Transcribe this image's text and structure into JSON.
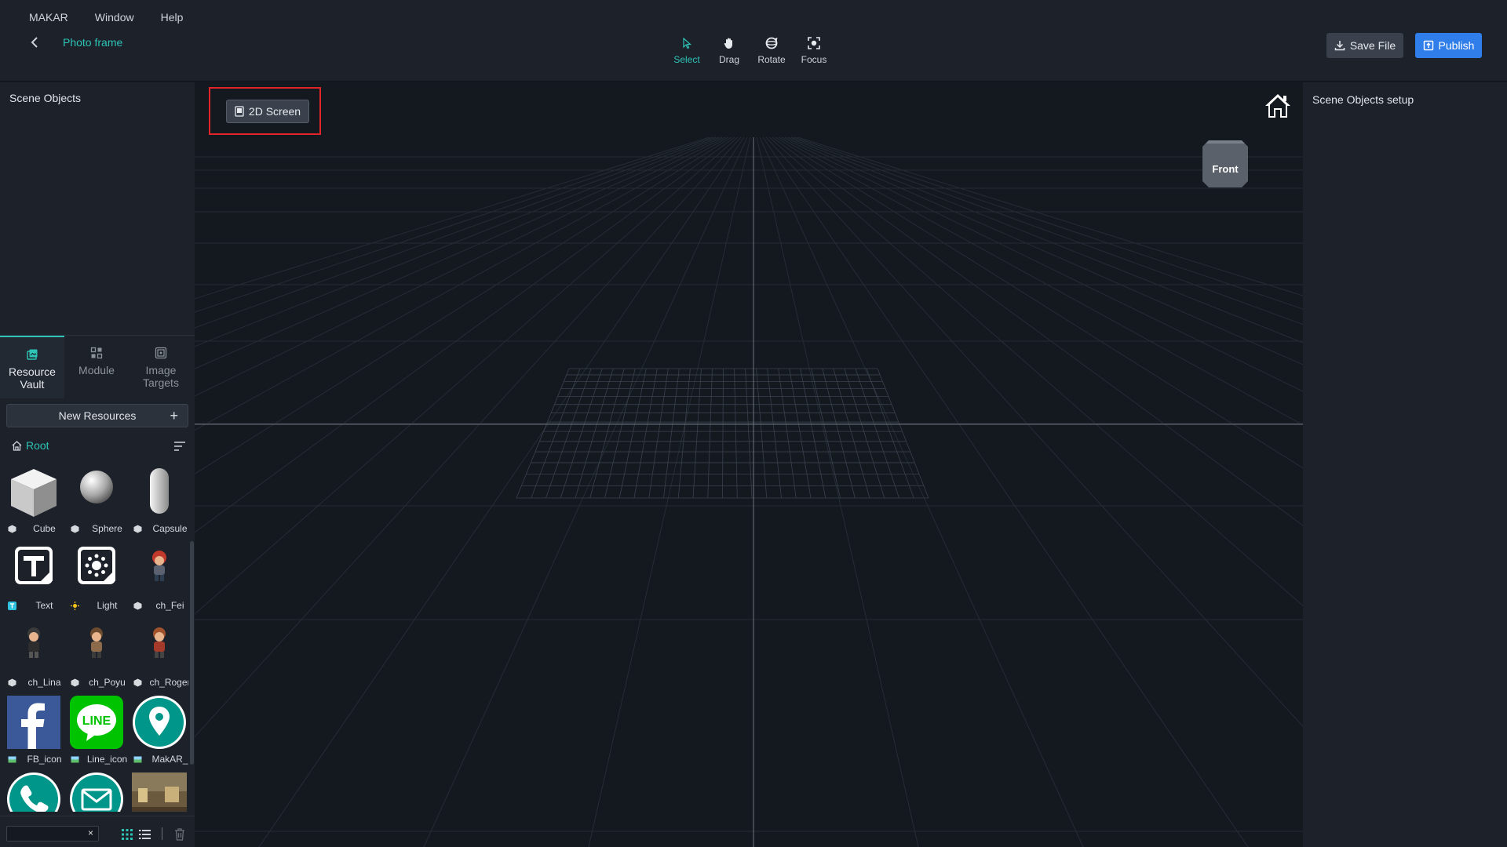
{
  "menu": {
    "items": [
      "MAKAR",
      "Window",
      "Help"
    ]
  },
  "header": {
    "project_name": "Photo frame"
  },
  "tools": [
    {
      "label": "Select",
      "icon": "cursor-icon",
      "active": true
    },
    {
      "label": "Drag",
      "icon": "hand-icon",
      "active": false
    },
    {
      "label": "Rotate",
      "icon": "rotate-icon",
      "active": false
    },
    {
      "label": "Focus",
      "icon": "focus-icon",
      "active": false
    }
  ],
  "actions": {
    "save_label": "Save File",
    "publish_label": "Publish"
  },
  "left_panel": {
    "title": "Scene Objects",
    "tabs": [
      {
        "label": "Resource\nVault",
        "icon": "resource-vault-icon",
        "active": true
      },
      {
        "label": "Module",
        "icon": "module-icon",
        "active": false
      },
      {
        "label": "Image\nTargets",
        "icon": "image-targets-icon",
        "active": false
      }
    ],
    "new_resources_label": "New Resources",
    "new_resources_plus": "+",
    "root_label": "Root",
    "resources": [
      {
        "name": "Cube",
        "type": "3d-model"
      },
      {
        "name": "Sphere",
        "type": "3d-model"
      },
      {
        "name": "Capsule",
        "type": "3d-model"
      },
      {
        "name": "Text",
        "type": "text"
      },
      {
        "name": "Light",
        "type": "light"
      },
      {
        "name": "ch_Fei",
        "type": "3d-model"
      },
      {
        "name": "ch_Lina",
        "type": "3d-model"
      },
      {
        "name": "ch_Poyu",
        "type": "3d-model"
      },
      {
        "name": "ch_Roger",
        "type": "3d-model"
      },
      {
        "name": "FB_icon",
        "type": "image"
      },
      {
        "name": "Line_icon",
        "type": "image"
      },
      {
        "name": "MakAR_",
        "type": "image"
      }
    ],
    "search_clear": "×"
  },
  "viewport": {
    "screen_button_label": "2D Screen",
    "view_cube_label": "Front"
  },
  "right_panel": {
    "title": "Scene Objects setup"
  },
  "colors": {
    "accent": "#2ec4b6",
    "publish": "#2f7ee9",
    "highlight": "#e0242a"
  }
}
